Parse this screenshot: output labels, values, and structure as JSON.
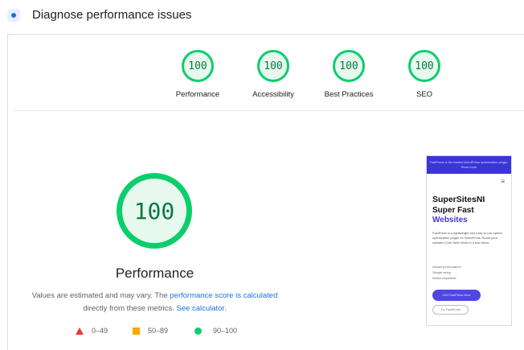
{
  "header": {
    "title": "Diagnose performance issues",
    "icon": "diagnose-icon"
  },
  "scores": [
    {
      "value": "100",
      "label": "Performance"
    },
    {
      "value": "100",
      "label": "Accessibility"
    },
    {
      "value": "100",
      "label": "Best Practices"
    },
    {
      "value": "100",
      "label": "SEO"
    }
  ],
  "main": {
    "score": "100",
    "label": "Performance",
    "desc_1": "Values are estimated and may vary. The ",
    "desc_link_1": "performance score is calculated",
    "desc_2": "directly from these metrics. ",
    "desc_link_2": "See calculator."
  },
  "legend": [
    {
      "range": "0–49",
      "shape": "triangle",
      "color": "#e53935"
    },
    {
      "range": "50–89",
      "shape": "square",
      "color": "#ffa400"
    },
    {
      "range": "90–100",
      "shape": "circle",
      "color": "#0cce6b"
    }
  ],
  "preview": {
    "banner": "FastPress is the fastest WordPress optimization plugin. Read more",
    "menu_icon": "≡",
    "brand": "SuperSitesNI",
    "headline_1": "Super Fast",
    "headline_2": "Websites",
    "body": "FastPress is a lightweight and easy to use speed optimization plugin for WordPress. Boost your website! Core Web Vitals in a few clicks.",
    "list": [
      "Instant performance",
      "Simple setup",
      "Works anywhere"
    ],
    "cta": "Get FastPress Now",
    "secondary": "Try FastPress"
  },
  "colors": {
    "pass": "#0cce6b",
    "average": "#ffa400",
    "fail": "#e53935",
    "link": "#1a73e8"
  }
}
